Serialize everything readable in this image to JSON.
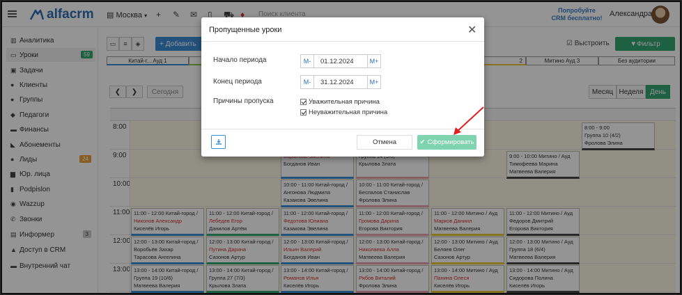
{
  "topbar": {
    "logo": "alfacrm",
    "branch": "Москва",
    "search_placeholder": "Поиск клиента",
    "promo_line1": "Попробуйте",
    "promo_line2": "CRM бесплатно!",
    "user_name": "Александра"
  },
  "sidebar": {
    "items": [
      {
        "label": "Аналитика",
        "icon": "chart-icon"
      },
      {
        "label": "Уроки",
        "icon": "calendar-icon",
        "badge": "59",
        "badge_color": "#35a673"
      },
      {
        "label": "Задачи",
        "icon": "tasks-icon"
      },
      {
        "label": "Клиенты",
        "icon": "user-icon"
      },
      {
        "label": "Группы",
        "icon": "users-icon"
      },
      {
        "label": "Педагоги",
        "icon": "teacher-icon"
      },
      {
        "label": "Финансы",
        "icon": "money-icon"
      },
      {
        "label": "Абонементы",
        "icon": "tag-icon"
      },
      {
        "label": "Лиды",
        "icon": "lead-icon",
        "badge": "24",
        "badge_color": "#e8a13a"
      },
      {
        "label": "Юр. лица",
        "icon": "building-icon"
      },
      {
        "label": "Podpislon",
        "icon": "doc-icon"
      },
      {
        "label": "Wazzup",
        "icon": "whatsapp-icon"
      },
      {
        "label": "Звонки",
        "icon": "phone-icon"
      },
      {
        "label": "Информер",
        "icon": "informer-icon",
        "badge": "3",
        "badge_color": "#bbbbbb"
      },
      {
        "label": "Доступ в CRM",
        "icon": "lock-icon"
      },
      {
        "label": "Внутренний чат",
        "icon": "chat-icon"
      }
    ]
  },
  "toolbar": {
    "add_label": "+ Добавить",
    "stretch_label": "Выстроить",
    "filter_label": "Фильтр"
  },
  "rooms": [
    {
      "label": "Китай-г... Ауд 1",
      "color": "#3c8dd6"
    },
    {
      "label": "",
      "color": "#8cc63f"
    },
    {
      "label": "",
      "color": "#ccc"
    },
    {
      "label": "",
      "color": "#ccc"
    },
    {
      "label": "2",
      "color": "#e8c53a"
    },
    {
      "label": "Митино Ауд 3",
      "color": "#999"
    },
    {
      "label": "Без аудитории",
      "color": "#999"
    }
  ],
  "nav": {
    "today": "Сегодня",
    "month": "Месяц",
    "week": "Неделя",
    "day": "День"
  },
  "calendar": {
    "hours": [
      "8:00",
      "9:00",
      "10:00",
      "11:00",
      "12:00",
      "13:00"
    ],
    "events": [
      {
        "l1": "8:00 - 9:00",
        "l2": "Группа 10 (4/2)",
        "l3": "Фролова Элина",
        "red": false
      },
      {
        "l1": "9:00 - 10:00 Митино / Ауд",
        "l2": "Тимофеева Марина",
        "l3": "Матвеева Валерия",
        "red": false
      },
      {
        "l1": "",
        "l2": "Баранова Эвелина",
        "l3": "Богданов Иван",
        "red": true
      },
      {
        "l1": "",
        "l2": "Группа 14 (9/6)",
        "l3": "Крылова Злата",
        "red": false
      },
      {
        "l1": "10:00 - 11:00 Китай-город /",
        "l2": "Ангонова Людмила",
        "l3": "Казакова Эвелина",
        "red": false
      },
      {
        "l1": "10:00 - 11:00 Китай-город /",
        "l2": "Беспалов Станислав",
        "l3": "Фролова Элина",
        "red": false
      },
      {
        "l1": "11:00 - 12:00 Китай-город /",
        "l2": "Никонов Александр",
        "l3": "Киселёв Игорь",
        "red": true
      },
      {
        "l1": "11:00 - 12:00 Китай-город /",
        "l2": "Лебедев Егор",
        "l3": "Данилов Артём",
        "red": true
      },
      {
        "l1": "11:00 - 12:00 Китай-город /",
        "l2": "Федотова Юлиана",
        "l3": "Казакова Эвелина",
        "red": true
      },
      {
        "l1": "11:00 - 12:00 Китай-город /",
        "l2": "Громова Дарина",
        "l3": "Егорова Виктория",
        "red": true
      },
      {
        "l1": "11:00 - 12:00 Митино / Ауд",
        "l2": "Марков Даниил",
        "l3": "Матвеева Валерия",
        "red": true
      },
      {
        "l1": "11:00 - 12:00 Митино / Ауд",
        "l2": "Федоров Дмитрий",
        "l3": "Егорова Виктория",
        "red": false
      },
      {
        "l1": "12:00 - 13:00 Китай-город /",
        "l2": "Воробьёв Захар",
        "l3": "Тарасова Ангелина",
        "red": false
      },
      {
        "l1": "12:00 - 13:00 Китай-город /",
        "l2": "Путина Дарина",
        "l3": "Сазонов Артур",
        "red": true
      },
      {
        "l1": "12:00 - 13:00 Китай-город /",
        "l2": "Ильин Валерий",
        "l3": "Богданов Иван",
        "red": true
      },
      {
        "l1": "12:00 - 13:00 Китай-город /",
        "l2": "Николаева Алла",
        "l3": "Матвеева Валерия",
        "red": true
      },
      {
        "l1": "12:00 - 13:00 Митино / Ауд",
        "l2": "Беляев Олег",
        "l3": "Сазонов Артур",
        "red": false
      },
      {
        "l1": "12:00 - 13:00 Митино / Ауд",
        "l2": "Группа 18 (6/4)",
        "l3": "Матвеева Валерия",
        "red": false
      },
      {
        "l1": "13:00 - 14:00 Китай-город /",
        "l2": "Группа 19 (10/6)",
        "l3": "Матвеева Валерия",
        "red": false
      },
      {
        "l1": "13:00 - 14:00 Китай-город /",
        "l2": "Группа 27 (7/3)",
        "l3": "Крылова Злата",
        "red": false
      },
      {
        "l1": "13:00 - 14:00 Китай-город /",
        "l2": "Романов Илья",
        "l3": "Киселёв Игорь",
        "red": true
      },
      {
        "l1": "13:00 - 14:00 Китай-город /",
        "l2": "Рябов Виталий",
        "l3": "Фролова Элина",
        "red": true
      },
      {
        "l1": "13:00 - 14:00 Митино / Ауд",
        "l2": "Панина Олеся",
        "l3": "Киселёв Игорь",
        "red": true
      },
      {
        "l1": "13:00 - 14:00 Митино / Ауд",
        "l2": "Сидорова Полина",
        "l3": "Киселёв Игорь",
        "red": false
      }
    ]
  },
  "modal": {
    "title": "Пропущенные уроки",
    "start_label": "Начало периода",
    "start_value": "01.12.2024",
    "end_label": "Конец периода",
    "end_value": "31.12.2024",
    "minus": "М-",
    "plus": "М+",
    "reasons_label": "Причины пропуска",
    "reason1": "Уважительная причина",
    "reason2": "Неуважительная причина",
    "cancel_label": "Отмена",
    "generate_label": "Сформировать"
  },
  "colors": {
    "accent": "#35a673",
    "brand": "#2d6db5",
    "annotation_arrow": "#e02020"
  }
}
